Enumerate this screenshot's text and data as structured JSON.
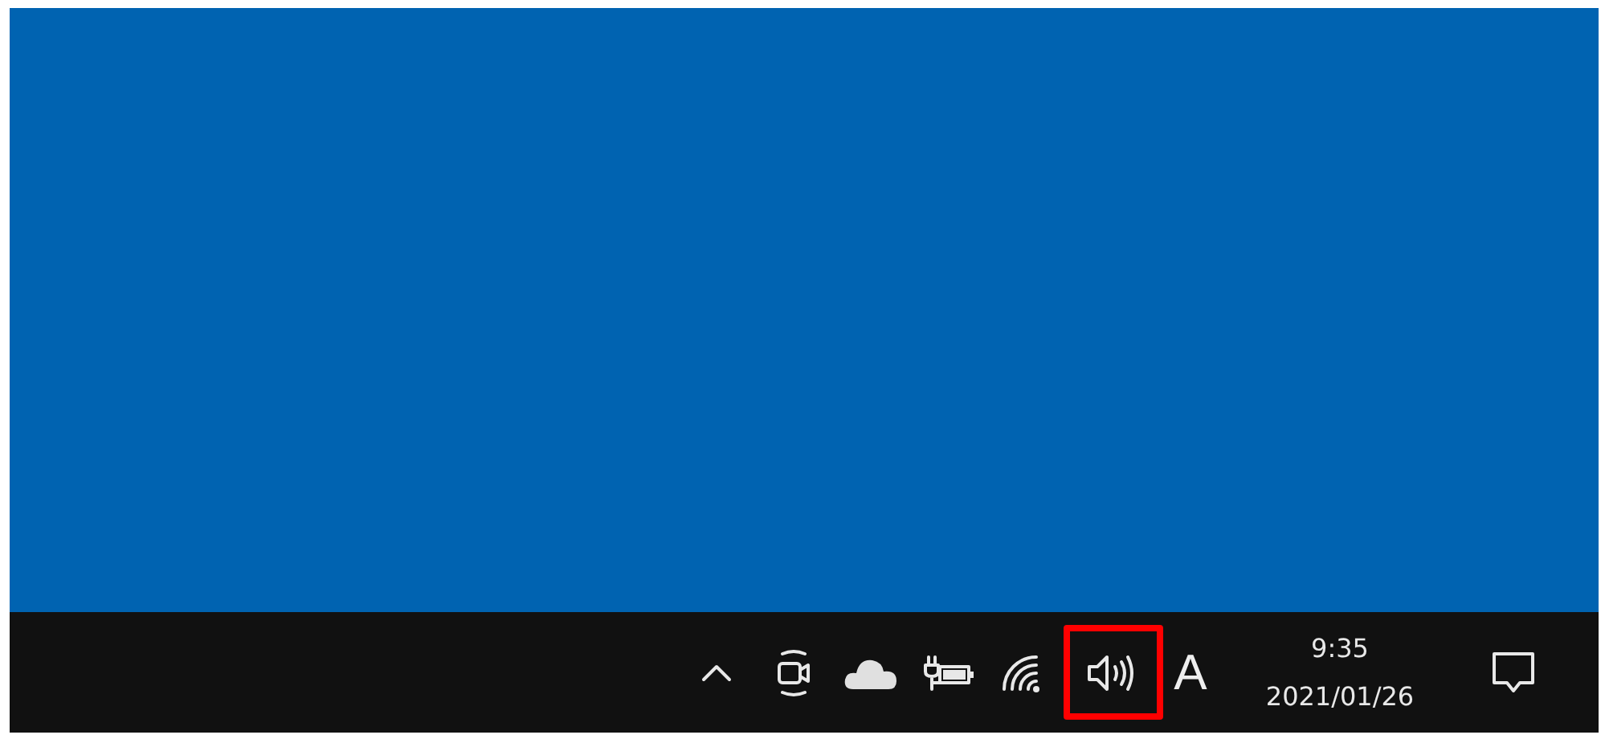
{
  "taskbar": {
    "tray_icons": [
      {
        "kind": "chevron",
        "highlighted": false
      },
      {
        "kind": "camera",
        "highlighted": false
      },
      {
        "kind": "cloud",
        "highlighted": false
      },
      {
        "kind": "battery",
        "highlighted": false
      },
      {
        "kind": "wifi",
        "highlighted": false
      },
      {
        "kind": "volume",
        "highlighted": true
      }
    ],
    "input_indicator": "A",
    "clock": {
      "time": "9:35",
      "date": "2021/01/26"
    }
  }
}
